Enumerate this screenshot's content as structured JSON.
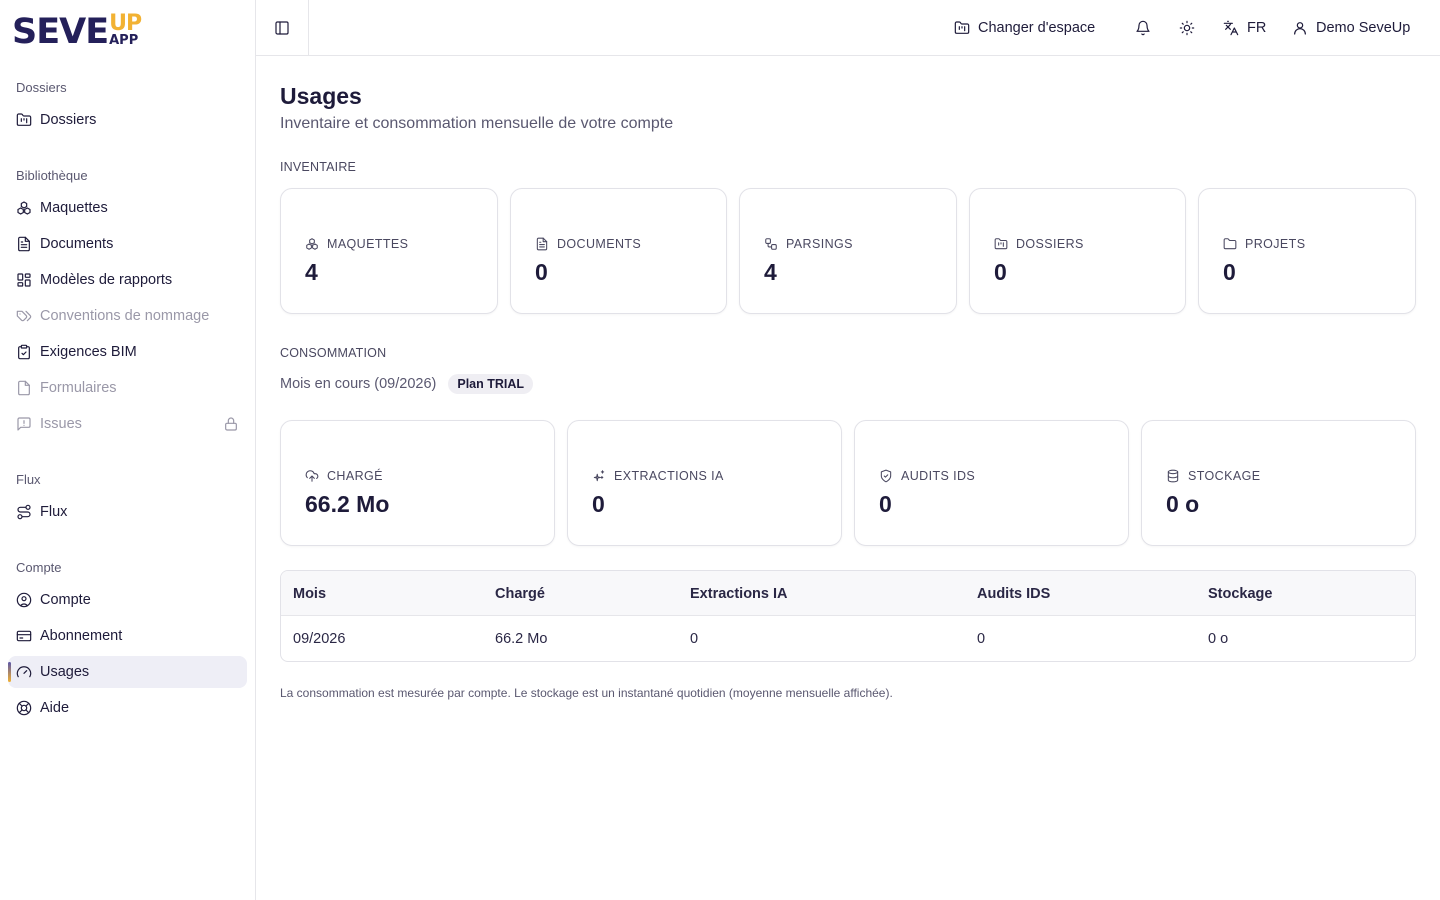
{
  "brand": {
    "main": "SEVE",
    "up": "UP",
    "app": "APP"
  },
  "sidebar": {
    "groups": [
      {
        "label": "Dossiers"
      },
      {
        "label": "Bibliothèque"
      },
      {
        "label": "Flux"
      },
      {
        "label": "Compte"
      }
    ],
    "items": [
      {
        "label": "Dossiers",
        "icon": "folder-kanban-icon"
      },
      {
        "label": "Maquettes",
        "icon": "boxes-icon"
      },
      {
        "label": "Documents",
        "icon": "file-text-icon"
      },
      {
        "label": "Modèles de rapports",
        "icon": "layout-dashboard-icon"
      },
      {
        "label": "Conventions de nommage",
        "icon": "tags-icon"
      },
      {
        "label": "Exigences BIM",
        "icon": "clipboard-check-icon"
      },
      {
        "label": "Formulaires",
        "icon": "file-icon"
      },
      {
        "label": "Issues",
        "icon": "message-square-alert-icon"
      },
      {
        "label": "Flux",
        "icon": "route-icon"
      },
      {
        "label": "Compte",
        "icon": "user-circle-icon"
      },
      {
        "label": "Abonnement",
        "icon": "credit-card-icon"
      },
      {
        "label": "Usages",
        "icon": "gauge-icon"
      },
      {
        "label": "Aide",
        "icon": "life-buoy-icon"
      }
    ]
  },
  "topbar": {
    "switch_space": "Changer d'espace",
    "language": "FR",
    "user": "Demo SeveUp"
  },
  "page": {
    "title": "Usages",
    "subtitle": "Inventaire et consommation mensuelle de votre compte"
  },
  "inventory": {
    "label": "INVENTAIRE",
    "cards": [
      {
        "label": "MAQUETTES",
        "value": "4"
      },
      {
        "label": "DOCUMENTS",
        "value": "0"
      },
      {
        "label": "PARSINGS",
        "value": "4"
      },
      {
        "label": "DOSSIERS",
        "value": "0"
      },
      {
        "label": "PROJETS",
        "value": "0"
      }
    ]
  },
  "consumption": {
    "label": "CONSOMMATION",
    "month": "Mois en cours (09/2026)",
    "plan": "Plan TRIAL",
    "cards": [
      {
        "label": "CHARGÉ",
        "value": "66.2 Mo"
      },
      {
        "label": "EXTRACTIONS IA",
        "value": "0"
      },
      {
        "label": "AUDITS IDS",
        "value": "0"
      },
      {
        "label": "STOCKAGE",
        "value": "0 o"
      }
    ]
  },
  "table": {
    "headers": [
      "Mois",
      "Chargé",
      "Extractions IA",
      "Audits IDS",
      "Stockage"
    ],
    "rows": [
      [
        "09/2026",
        "66.2 Mo",
        "0",
        "0",
        "0 o"
      ]
    ]
  },
  "footnote": "La consommation est mesurée par compte. Le stockage est un instantané quotidien (moyenne mensuelle affichée).",
  "colors": {
    "brand_dark": "#24205a",
    "brand_accent": "#f2b233",
    "active_bg": "#eeeef6"
  }
}
